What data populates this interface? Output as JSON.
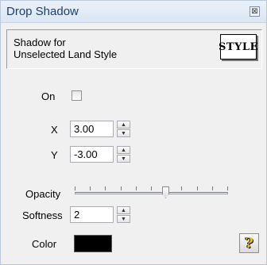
{
  "window": {
    "title": "Drop Shadow",
    "close_glyph": "⊠"
  },
  "header": {
    "description": "Shadow for\nUnselected Land Style",
    "style_preview_text": "STYLE"
  },
  "on": {
    "label": "On",
    "checked": false
  },
  "x": {
    "label": "X",
    "value": "3.00"
  },
  "y": {
    "label": "Y",
    "value": "-3.00"
  },
  "opacity": {
    "label": "Opacity",
    "level_fraction": 0.6
  },
  "softness": {
    "label": "Softness",
    "value": "2"
  },
  "color": {
    "label": "Color",
    "value": "#000000"
  },
  "help": {
    "glyph": "?"
  },
  "icons": {
    "spin_up": "▲",
    "spin_down": "▼"
  }
}
